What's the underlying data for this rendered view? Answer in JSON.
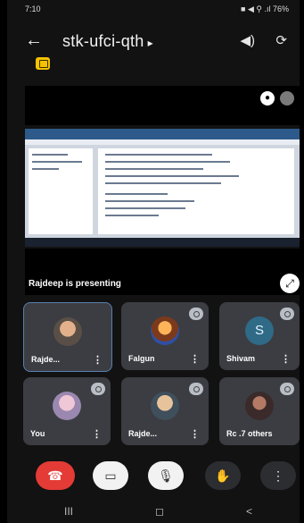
{
  "status_bar": {
    "time": "7:10",
    "icons": "■ ◀ ⚲ .ıl 76%"
  },
  "header": {
    "title": "stk-ufci-qth",
    "chevron": "▸"
  },
  "presentation": {
    "presenter_text": "Rajdeep is presenting"
  },
  "tiles": [
    {
      "name": "Rajde...",
      "avatar": "photo"
    },
    {
      "name": "Falgun",
      "avatar": "photo"
    },
    {
      "name": "Shivam",
      "avatar": "letter",
      "letter": "S"
    },
    {
      "name": "You",
      "avatar": "photo"
    },
    {
      "name": "Rajde...",
      "avatar": "photo"
    },
    {
      "name": "Rc .7 others",
      "avatar": "photo"
    }
  ],
  "more_glyph": "⋮",
  "controls": {
    "end_call_icon": "phone-end-icon",
    "camera_icon": "camera-off-icon",
    "mic_icon": "mic-off-icon",
    "hand_icon": "raise-hand-icon",
    "more_icon": "more-vert-icon"
  },
  "colors": {
    "end_call": "#e43b36",
    "tile_bg": "#3b3d42",
    "active_border": "#5a7fb0",
    "badge": "#f4c200"
  },
  "nav": {
    "recents": "III",
    "home": "◻",
    "back": "<"
  }
}
